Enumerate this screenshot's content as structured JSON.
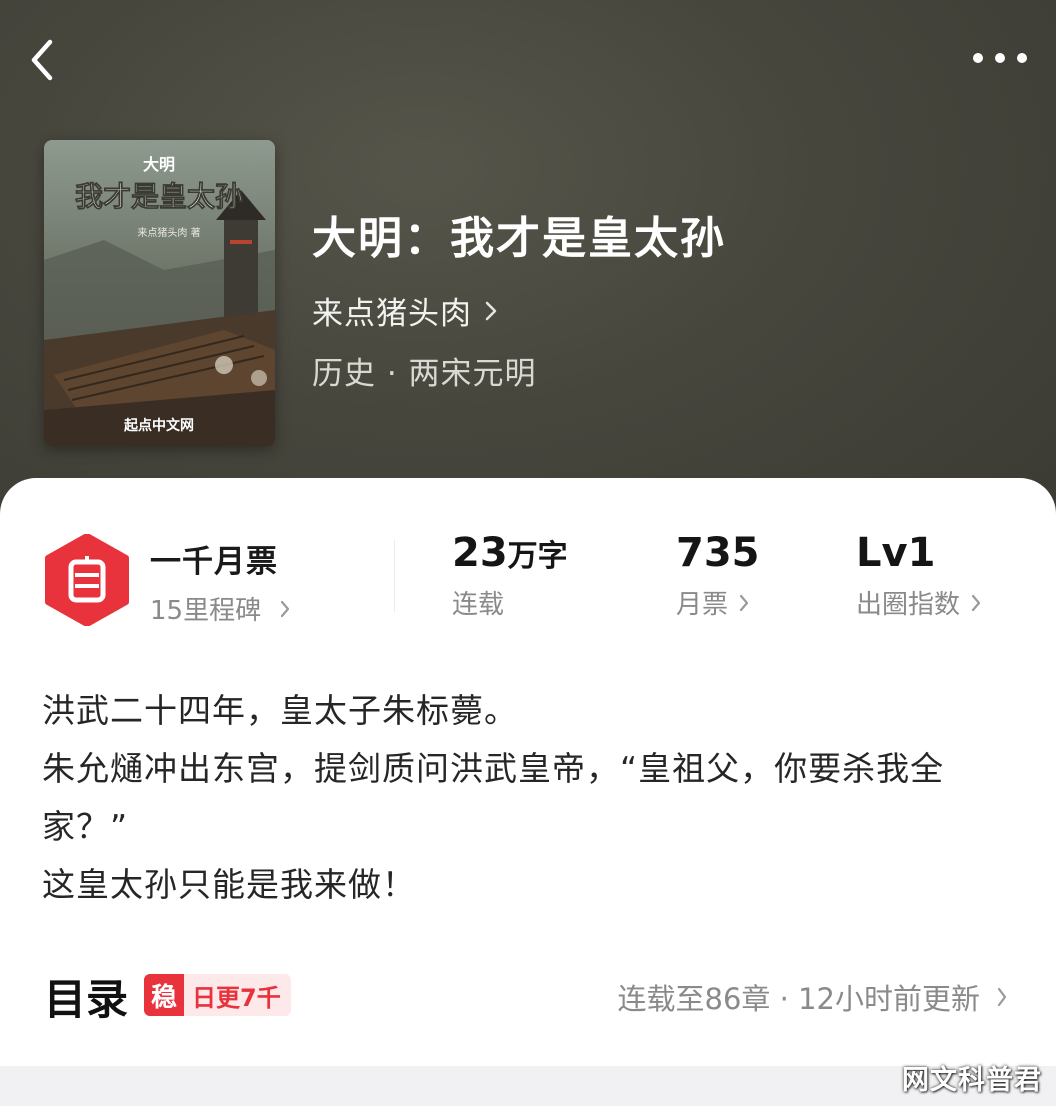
{
  "book": {
    "cover": {
      "series": "大明",
      "title": "我才是皇太孙",
      "author_line": "来点猪头肉 著",
      "publisher": "起点中文网"
    },
    "title": "大明：我才是皇太孙",
    "author": "来点猪头肉",
    "genre": "历史 · 两宋元明"
  },
  "stats": {
    "ticket_badge": {
      "icon": "ticket-icon",
      "title": "一千月票",
      "subtitle": "15里程碑"
    },
    "words": {
      "value": "23",
      "unit": "万字",
      "label": "连载"
    },
    "votes": {
      "value": "735",
      "label": "月票"
    },
    "level": {
      "value": "Lv1",
      "label": "出圈指数"
    }
  },
  "synopsis": [
    "洪武二十四年，皇太子朱标薨。",
    "朱允熥冲出东宫，提剑质问洪武皇帝，“皇祖父，你要杀我全家？”",
    "这皇太孙只能是我来做！"
  ],
  "toc": {
    "title": "目录",
    "tag_mark": "稳",
    "tag_text": "日更7千",
    "status": "连载至86章 · 12小时前更新"
  },
  "watermark": "网文科普君",
  "colors": {
    "hero_bg": "#46463d",
    "accent_red": "#e8323c",
    "card_bg": "#ffffff",
    "muted_text": "#8a8a8a"
  }
}
